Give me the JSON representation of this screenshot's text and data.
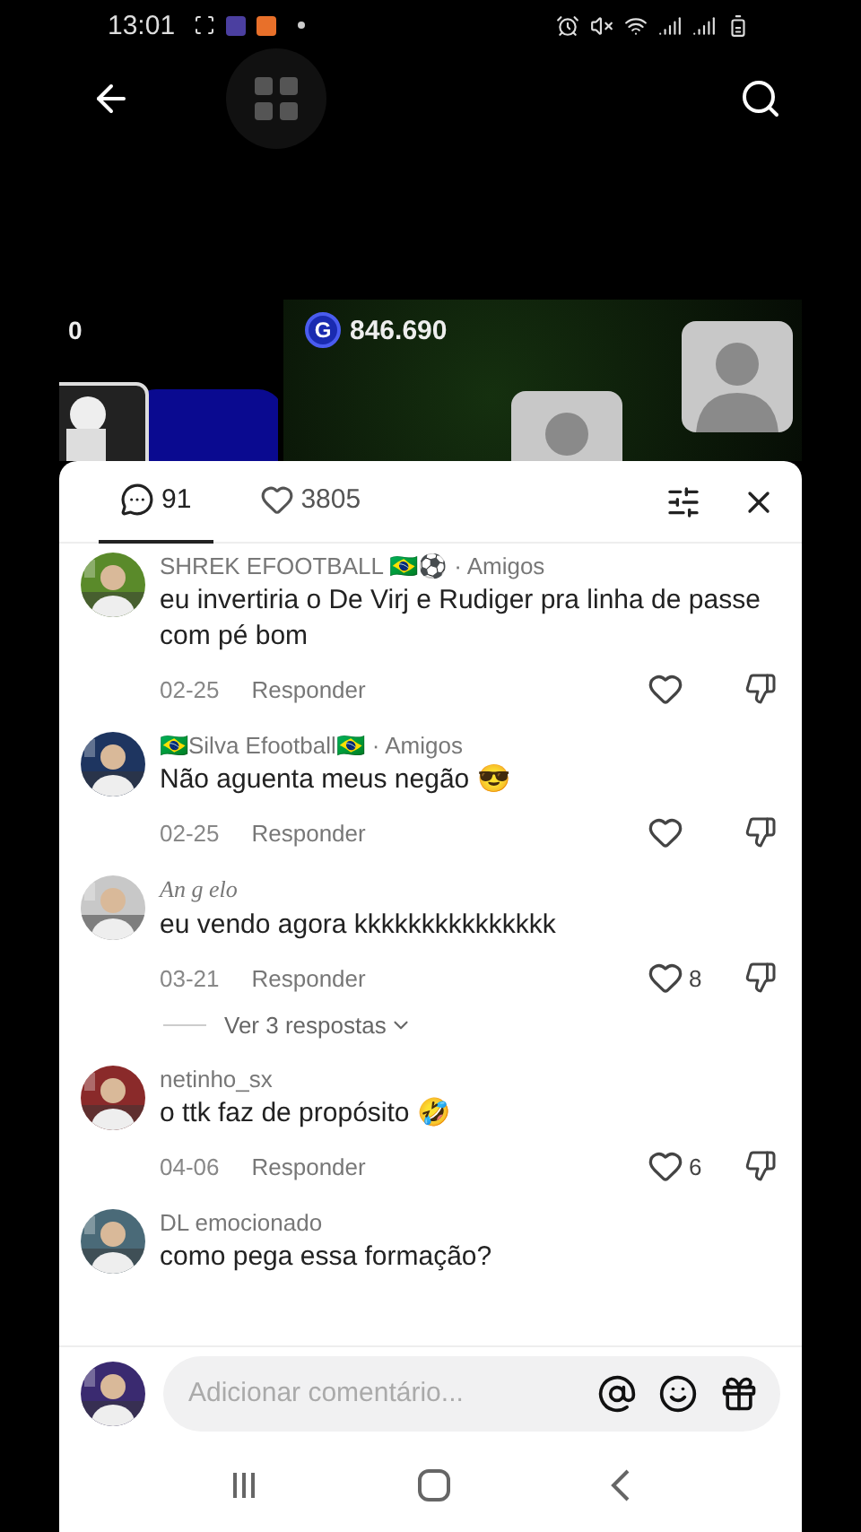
{
  "status_bar": {
    "time": "13:01"
  },
  "video": {
    "left_score": "0",
    "coins": "846.690",
    "coin_letter": "G"
  },
  "sheet": {
    "tabs": [
      {
        "kind": "comments",
        "count": "91",
        "selected": true
      },
      {
        "kind": "likes",
        "count": "3805",
        "selected": false
      }
    ],
    "comments": [
      {
        "author": "SHREK EFOOTBALL 🇧🇷⚽",
        "relation": "· Amigos",
        "text": "eu invertiria o De Virj e Rudiger pra linha de passe com pé bom",
        "date": "02-25",
        "reply": "Responder"
      },
      {
        "author": "🇧🇷Silva Efootball🇧🇷",
        "relation": "· Amigos",
        "text": "Não aguenta meus negão 😎",
        "date": "02-25",
        "reply": "Responder"
      },
      {
        "author": "An g elo",
        "script": true,
        "text": "eu vendo agora kkkkkkkkkkkkkkk",
        "date": "03-21",
        "reply": "Responder",
        "likes": "8",
        "replies": "Ver 3 respostas"
      },
      {
        "author": "netinho_sx",
        "text": "o ttk faz de propósito 🤣",
        "date": "04-06",
        "reply": "Responder",
        "likes": "6"
      },
      {
        "author": "DL emocionado",
        "text": "como pega essa formação?"
      }
    ],
    "input": {
      "placeholder": "Adicionar comentário..."
    }
  }
}
